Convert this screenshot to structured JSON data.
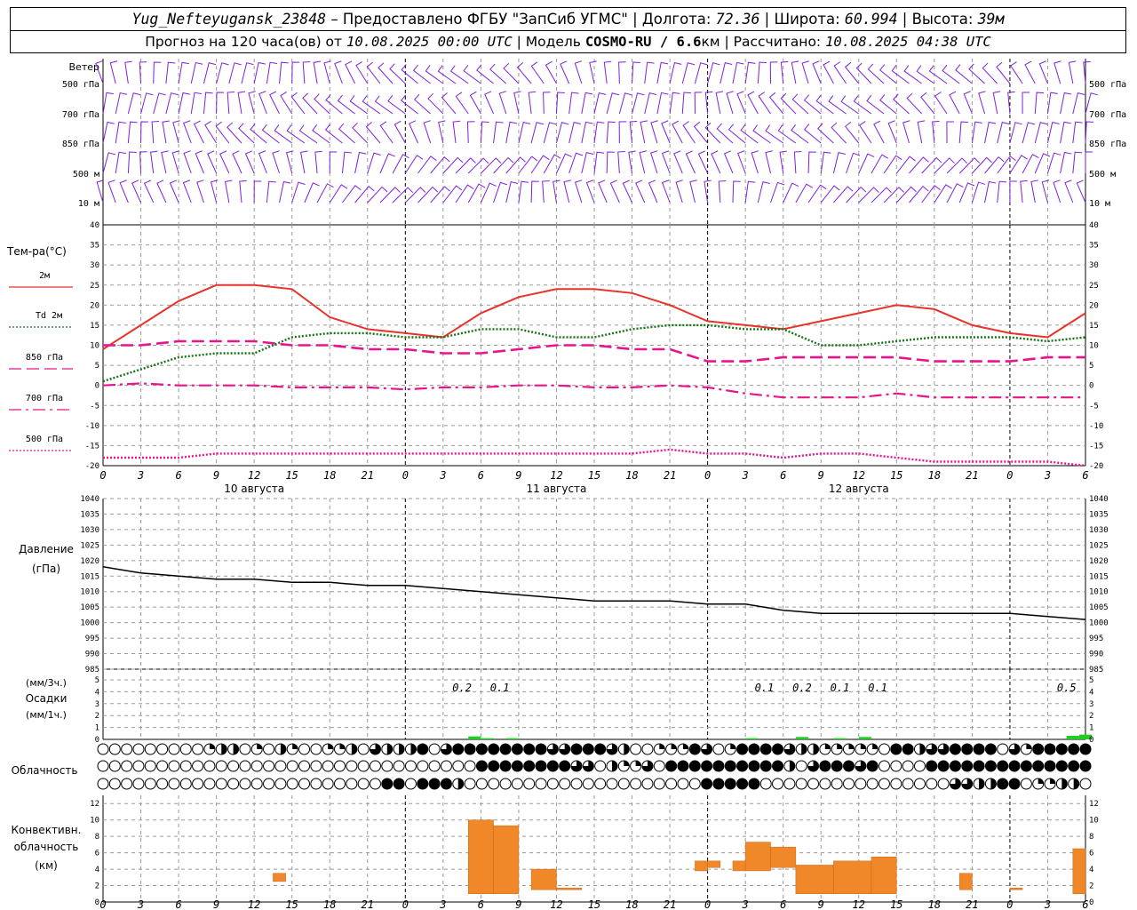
{
  "header": {
    "station": "Yug_Nefteyugansk_23848",
    "provider": "Предоставлено ФГБУ \"ЗапСиб УГМС\"",
    "lon_label": "Долгота:",
    "lon": "72.36",
    "lat_label": "Широта:",
    "lat": "60.994",
    "alt_label": "Высота:",
    "alt": "39м",
    "forecast_text": "Прогноз на 120 часа(ов) от",
    "start": "10.08.2025 00:00 UTC",
    "model_label": "Модель",
    "model": "COSMO-RU / 6.6",
    "model_unit": "км",
    "calc_label": "Рассчитано:",
    "calc": "10.08.2025 04:38 UTC"
  },
  "chart_data": [
    {
      "type": "line",
      "panel": "wind",
      "ylabel": "Ветер",
      "levels": [
        "500 гПа",
        "700 гПа",
        "850 гПа",
        "500 м",
        "10 м"
      ],
      "series_colors": {
        "barbs": "#7f1fdf"
      }
    },
    {
      "type": "line",
      "panel": "temperature",
      "ylabel": "Тем-ра(°C)",
      "ylim": [
        -20,
        40
      ],
      "yticks": [
        40,
        35,
        30,
        25,
        20,
        15,
        10,
        5,
        0,
        -5,
        -10,
        -15,
        -20
      ],
      "x_hours": [
        0,
        3,
        6,
        9,
        12,
        15,
        18,
        21,
        24,
        27,
        30,
        33,
        36,
        39,
        42,
        45,
        48,
        51,
        54,
        57,
        60,
        63,
        66,
        69,
        72,
        75,
        78
      ],
      "series": [
        {
          "name": "2м",
          "color": "#e8322b",
          "style": "solid",
          "values": [
            9,
            15,
            21,
            25,
            25,
            24,
            17,
            14,
            13,
            12,
            18,
            22,
            24,
            24,
            23,
            20,
            16,
            15,
            14,
            16,
            18,
            20,
            19,
            15,
            13,
            12,
            18
          ]
        },
        {
          "name": "Td 2м",
          "color": "#137313",
          "style": "dotted",
          "values": [
            1,
            4,
            7,
            8,
            8,
            12,
            13,
            13,
            12,
            12,
            14,
            14,
            12,
            12,
            14,
            15,
            15,
            14,
            14,
            10,
            10,
            11,
            12,
            12,
            12,
            11,
            12
          ]
        },
        {
          "name": "850 гПа",
          "color": "#e8148c",
          "style": "dashed",
          "values": [
            10,
            10,
            11,
            11,
            11,
            10,
            10,
            9,
            9,
            8,
            8,
            9,
            10,
            10,
            9,
            9,
            6,
            6,
            7,
            7,
            7,
            7,
            6,
            6,
            6,
            7,
            7
          ]
        },
        {
          "name": "700 гПа",
          "color": "#e8148c",
          "style": "dashdot",
          "values": [
            0,
            0.5,
            0,
            0,
            0,
            -0.5,
            -0.5,
            -0.5,
            -1,
            -0.5,
            -0.5,
            0,
            0,
            -0.5,
            -0.5,
            0,
            -0.5,
            -2,
            -3,
            -3,
            -3,
            -2,
            -3,
            -3,
            -3,
            -3,
            -3
          ]
        },
        {
          "name": "500 гПа",
          "color": "#e8148c",
          "style": "dotted",
          "values": [
            -18,
            -18,
            -18,
            -17,
            -17,
            -17,
            -17,
            -17,
            -17,
            -17,
            -17,
            -17,
            -17,
            -17,
            -17,
            -16,
            -17,
            -17,
            -18,
            -17,
            -17,
            -18,
            -19,
            -19,
            -19,
            -19,
            -20
          ]
        }
      ]
    },
    {
      "type": "line",
      "panel": "pressure",
      "ylabel": "Давление",
      "ylabel2": "(гПа)",
      "ylim": [
        985,
        1040
      ],
      "yticks": [
        1040,
        1035,
        1030,
        1025,
        1020,
        1015,
        1010,
        1005,
        1000,
        995,
        990,
        985
      ],
      "x_hours": [
        0,
        3,
        6,
        9,
        12,
        15,
        18,
        21,
        24,
        27,
        30,
        33,
        36,
        39,
        42,
        45,
        48,
        51,
        54,
        57,
        60,
        63,
        66,
        69,
        72,
        75,
        78
      ],
      "series": [
        {
          "name": "pressure",
          "color": "#000000",
          "values": [
            1018,
            1016,
            1015,
            1014,
            1014,
            1013,
            1013,
            1012,
            1012,
            1011,
            1010,
            1009,
            1008,
            1007,
            1007,
            1007,
            1006,
            1006,
            1004,
            1003,
            1003,
            1003,
            1003,
            1003,
            1003,
            1002,
            1001
          ]
        }
      ]
    },
    {
      "type": "bar",
      "panel": "precipitation",
      "ylabel": "(мм/3ч.)",
      "ylabel2": "Осадки",
      "ylabel3": "(мм/1ч.)",
      "ylim": [
        0,
        5
      ],
      "yticks": [
        5,
        4,
        3,
        2,
        1,
        0
      ],
      "color": "#22cc22",
      "bars": [
        {
          "x": 29.5,
          "value": 0.25
        },
        {
          "x": 30.5,
          "value": 0.1
        },
        {
          "x": 32.5,
          "value": 0.1
        },
        {
          "x": 51.5,
          "value": 0.1
        },
        {
          "x": 55.5,
          "value": 0.2
        },
        {
          "x": 58.5,
          "value": 0.1
        },
        {
          "x": 60.5,
          "value": 0.2
        },
        {
          "x": 77.0,
          "value": 0.3
        },
        {
          "x": 78.0,
          "value": 0.4
        }
      ],
      "annotations": [
        {
          "x": 28.5,
          "text": "0.2"
        },
        {
          "x": 31.5,
          "text": "0.1"
        },
        {
          "x": 52.5,
          "text": "0.1"
        },
        {
          "x": 55.5,
          "text": "0.2"
        },
        {
          "x": 58.5,
          "text": "0.1"
        },
        {
          "x": 61.5,
          "text": "0.1"
        },
        {
          "x": 76.5,
          "text": "0.5"
        }
      ]
    },
    {
      "type": "table",
      "panel": "cloudiness",
      "ylabel": "Облачность",
      "rows": [
        "000000000122010210011203222403444444443344432001114301444432211111044233444403144444",
        "000000000000000000000000000000004444444433021130444444444420344434000044444444444444",
        "000000000000000000000000440444200000000000000000000444440000000000000000332244011220"
      ]
    },
    {
      "type": "bar",
      "panel": "convective",
      "ylabel": "Конвективн.",
      "ylabel2": "облачность",
      "ylabel3": "(км)",
      "ylim": [
        0,
        12
      ],
      "yticks": [
        12,
        10,
        8,
        6,
        4,
        2,
        0
      ],
      "color": "#f0882a",
      "bars": [
        {
          "x0": 13.5,
          "x1": 14.5,
          "base": 2.5,
          "top": 3.5
        },
        {
          "x0": 29.0,
          "x1": 31.0,
          "base": 1.0,
          "top": 10.0
        },
        {
          "x0": 31.0,
          "x1": 33.0,
          "base": 1.0,
          "top": 9.3
        },
        {
          "x0": 34.0,
          "x1": 36.0,
          "base": 1.5,
          "top": 4.0
        },
        {
          "x0": 36.0,
          "x1": 38.0,
          "base": 1.5,
          "top": 1.7
        },
        {
          "x0": 47.0,
          "x1": 48.0,
          "base": 3.8,
          "top": 5.0
        },
        {
          "x0": 48.0,
          "x1": 49.0,
          "base": 4.2,
          "top": 5.0
        },
        {
          "x0": 50.0,
          "x1": 51.0,
          "base": 3.8,
          "top": 5.0
        },
        {
          "x0": 51.0,
          "x1": 53.0,
          "base": 3.8,
          "top": 7.3
        },
        {
          "x0": 53.0,
          "x1": 55.0,
          "base": 4.2,
          "top": 6.7
        },
        {
          "x0": 55.0,
          "x1": 58.0,
          "base": 1.0,
          "top": 4.5
        },
        {
          "x0": 58.0,
          "x1": 61.0,
          "base": 1.0,
          "top": 5.0
        },
        {
          "x0": 61.0,
          "x1": 63.0,
          "base": 1.0,
          "top": 5.5
        },
        {
          "x0": 68.0,
          "x1": 69.0,
          "base": 1.5,
          "top": 3.5
        },
        {
          "x0": 72.0,
          "x1": 73.0,
          "base": 1.5,
          "top": 1.7
        },
        {
          "x0": 77.0,
          "x1": 78.0,
          "base": 1.0,
          "top": 6.5
        }
      ]
    }
  ],
  "xaxis": {
    "hour_labels": [
      "0",
      "3",
      "6",
      "9",
      "12",
      "15",
      "18",
      "21",
      "0",
      "3",
      "6",
      "9",
      "12",
      "15",
      "18",
      "21",
      "0",
      "3",
      "6",
      "9",
      "12",
      "15",
      "18",
      "21",
      "0",
      "3",
      "6"
    ],
    "day_labels": [
      "10 августа",
      "11 августа",
      "12 августа"
    ]
  }
}
